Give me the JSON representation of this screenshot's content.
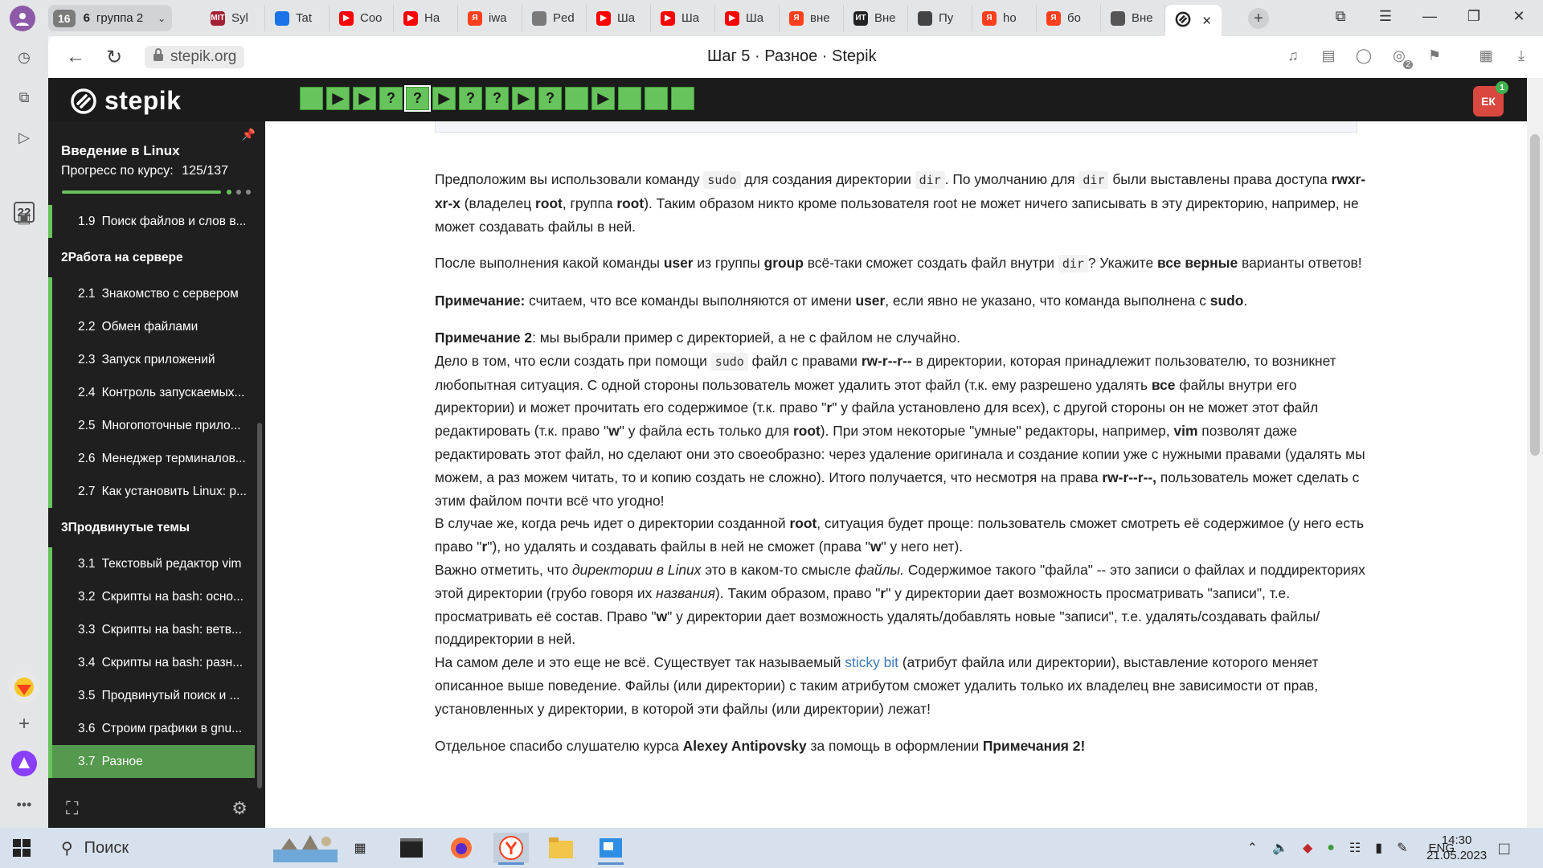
{
  "browser": {
    "tab_group": {
      "count": "16",
      "group_count": "6",
      "group_name": "группа 2"
    },
    "tabs": [
      {
        "label": "Syl",
        "fav_text": "MIT",
        "fav_color": "#a31f34"
      },
      {
        "label": "Tat",
        "fav_text": "",
        "fav_color": "#1a73e8"
      },
      {
        "label": "Coo",
        "fav_text": "▶",
        "fav_color": "#ff0000"
      },
      {
        "label": "Ha",
        "fav_text": "▶",
        "fav_color": "#ff0000"
      },
      {
        "label": "iwa",
        "fav_text": "Я",
        "fav_color": "#fc3f1d"
      },
      {
        "label": "Ped",
        "fav_text": "",
        "fav_color": "#7a7a7a"
      },
      {
        "label": "Ша",
        "fav_text": "▶",
        "fav_color": "#ff0000"
      },
      {
        "label": "Ша",
        "fav_text": "▶",
        "fav_color": "#ff0000"
      },
      {
        "label": "Ша",
        "fav_text": "▶",
        "fav_color": "#ff0000"
      },
      {
        "label": "вне",
        "fav_text": "Я",
        "fav_color": "#fc3f1d"
      },
      {
        "label": "Вне",
        "fav_text": "ИТ",
        "fav_color": "#222222"
      },
      {
        "label": "Пу",
        "fav_text": "",
        "fav_color": "#444444"
      },
      {
        "label": "ho",
        "fav_text": "Я",
        "fav_color": "#fc3f1d"
      },
      {
        "label": "бо",
        "fav_text": "Я",
        "fav_color": "#fc3f1d"
      },
      {
        "label": "Вне",
        "fav_text": "",
        "fav_color": "#555555"
      }
    ],
    "url": "stepik.org",
    "page_title": "Шаг 5 · Разное · Stepik",
    "sidebar_badge": "22",
    "addr_icon_badge": "2"
  },
  "stepik": {
    "logo_text": "stepik",
    "steps": [
      "",
      "▶",
      "▶",
      "?",
      "?",
      "▶",
      "?",
      "?",
      "▶",
      "?",
      "",
      "▶",
      "",
      "",
      ""
    ],
    "current_step_index": 4,
    "avatar_initials": "ЕК",
    "avatar_notifications": "1",
    "course_title": "Введение в Linux",
    "progress_label": "Прогресс по курсу:",
    "progress_value": "125/137",
    "progress_fraction": 0.912
  },
  "course_nav": [
    {
      "type": "item",
      "num": "1.9",
      "label": "Поиск файлов и слов в..."
    },
    {
      "type": "section",
      "num": "2",
      "label": "Работа на сервере"
    },
    {
      "type": "item",
      "num": "2.1",
      "label": "Знакомство с сервером"
    },
    {
      "type": "item",
      "num": "2.2",
      "label": "Обмен файлами"
    },
    {
      "type": "item",
      "num": "2.3",
      "label": "Запуск приложений"
    },
    {
      "type": "item",
      "num": "2.4",
      "label": "Контроль запускаемых..."
    },
    {
      "type": "item",
      "num": "2.5",
      "label": "Многопоточные прило..."
    },
    {
      "type": "item",
      "num": "2.6",
      "label": "Менеджер терминалов..."
    },
    {
      "type": "item",
      "num": "2.7",
      "label": "Как установить Linux: р..."
    },
    {
      "type": "section",
      "num": "3",
      "label": "Продвинутые темы"
    },
    {
      "type": "item",
      "num": "3.1",
      "label": "Текстовый редактор vim"
    },
    {
      "type": "item",
      "num": "3.2",
      "label": "Скрипты на bash: осно..."
    },
    {
      "type": "item",
      "num": "3.3",
      "label": "Скрипты на bash: ветв..."
    },
    {
      "type": "item",
      "num": "3.4",
      "label": "Скрипты на bash: разн..."
    },
    {
      "type": "item",
      "num": "3.5",
      "label": "Продвинутый поиск и ..."
    },
    {
      "type": "item",
      "num": "3.6",
      "label": "Строим графики в gnu..."
    },
    {
      "type": "item",
      "num": "3.7",
      "label": "Разное",
      "active": true
    }
  ],
  "lesson": {
    "p1": [
      {
        "t": "Предположим вы использовали команду "
      },
      {
        "t": "sudo",
        "f": "code"
      },
      {
        "t": " для создания директории "
      },
      {
        "t": "dir",
        "f": "code"
      },
      {
        "t": ". По умолчанию для "
      },
      {
        "t": "dir",
        "f": "code"
      },
      {
        "t": " были выставлены права доступа "
      },
      {
        "t": "rwxr-xr-x",
        "f": "b"
      },
      {
        "t": " (владелец "
      },
      {
        "t": "root",
        "f": "b"
      },
      {
        "t": ", группа "
      },
      {
        "t": "root",
        "f": "b"
      },
      {
        "t": "). Таким образом никто кроме пользователя root не может ничего записывать в эту директорию, например, не может создавать файлы в ней."
      }
    ],
    "p2": [
      {
        "t": "После выполнения какой команды "
      },
      {
        "t": "user",
        "f": "b"
      },
      {
        "t": " из группы "
      },
      {
        "t": "group",
        "f": "b"
      },
      {
        "t": " всё-таки сможет создать файл внутри "
      },
      {
        "t": "dir",
        "f": "code"
      },
      {
        "t": "? Укажите "
      },
      {
        "t": "все верные",
        "f": "b"
      },
      {
        "t": " варианты ответов!"
      }
    ],
    "p3": [
      {
        "t": "Примечание:",
        "f": "b"
      },
      {
        "t": " считаем, что все команды выполняются от имени "
      },
      {
        "t": "user",
        "f": "b"
      },
      {
        "t": ", если явно не указано, что команда выполнена с "
      },
      {
        "t": "sudo",
        "f": "b"
      },
      {
        "t": "."
      }
    ],
    "p4": [
      {
        "t": "Примечание 2",
        "f": "b"
      },
      {
        "t": ": мы выбрали пример с директорией, а не с файлом не случайно."
      },
      {
        "t": "",
        "f": "br"
      },
      {
        "t": "Дело в том, что если создать при помощи "
      },
      {
        "t": "sudo",
        "f": "code"
      },
      {
        "t": " файл с правами "
      },
      {
        "t": "rw-r--r--",
        "f": "b"
      },
      {
        "t": " в директории, которая принадлежит пользователю, то возникнет любопытная ситуация. С одной стороны пользователь может удалить этот файл (т.к. ему разрешено удалять "
      },
      {
        "t": "все",
        "f": "b"
      },
      {
        "t": " файлы внутри его директории) и может прочитать его содержимое (т.к. право \""
      },
      {
        "t": "r",
        "f": "b"
      },
      {
        "t": "\" у файла установлено для всех), с другой стороны он не может этот файл редактировать (т.к. право \""
      },
      {
        "t": "w",
        "f": "b"
      },
      {
        "t": "\" у файла есть только для "
      },
      {
        "t": "root",
        "f": "b"
      },
      {
        "t": "). При этом некоторые \"умные\" редакторы, например, "
      },
      {
        "t": "vim",
        "f": "b"
      },
      {
        "t": " позволят даже редактировать этот файл, но сделают они это своеобразно: через удаление оригинала и создание копии уже с нужными правами (удалять мы можем, а раз можем читать, то и копию создать не сложно). Итого получается, что несмотря на права  "
      },
      {
        "t": "rw-r--r--,",
        "f": "b"
      },
      {
        "t": " пользователь может сделать с этим файлом почти всё что угодно!"
      },
      {
        "t": "",
        "f": "br"
      },
      {
        "t": "В случае же, когда речь идет о директории созданной "
      },
      {
        "t": "root",
        "f": "b"
      },
      {
        "t": ", ситуация будет проще: пользователь сможет смотреть её содержимое (у него есть право \""
      },
      {
        "t": "r",
        "f": "b"
      },
      {
        "t": "\"), но удалять и создавать файлы в ней не сможет (права \""
      },
      {
        "t": "w",
        "f": "b"
      },
      {
        "t": "\" у него нет)."
      },
      {
        "t": "",
        "f": "br"
      },
      {
        "t": "Важно отметить, что "
      },
      {
        "t": "директории в Linux",
        "f": "i"
      },
      {
        "t": " это в каком-то смысле "
      },
      {
        "t": "файлы.",
        "f": "i"
      },
      {
        "t": " Содержимое такого \"файла\" -- это записи о файлах и поддиректориях этой директории (грубо говоря их "
      },
      {
        "t": "названия",
        "f": "i"
      },
      {
        "t": "). Таким образом, право \""
      },
      {
        "t": "r",
        "f": "b"
      },
      {
        "t": "\" у директории дает возможность просматривать \"записи\", т.е. просматривать её состав. Право \""
      },
      {
        "t": "w",
        "f": "b"
      },
      {
        "t": "\" у директории дает возможность удалять/добавлять новые \"записи\", т.е. удалять/создавать файлы/поддиректории в ней."
      },
      {
        "t": "",
        "f": "br"
      },
      {
        "t": "На самом деле и это еще не всё. Существует так называемый "
      },
      {
        "t": "sticky bit",
        "f": "a"
      },
      {
        "t": " (атрибут файла или директории), выставление которого меняет описанное выше поведение. Файлы (или директории) с таким атрибутом сможет удалить только их владелец вне зависимости от прав, установленных у директории, в которой эти файлы (или директории) лежат!"
      }
    ],
    "p5": [
      {
        "t": "Отдельное спасибо слушателю курса "
      },
      {
        "t": "Alexey Antipovsky",
        "f": "b"
      },
      {
        "t": " за помощь в оформлении "
      },
      {
        "t": "Примечания 2!",
        "f": "b"
      }
    ]
  },
  "taskbar": {
    "search_placeholder": "Поиск",
    "lang": "ENG",
    "time": "14:30",
    "date": "21.05.2023"
  },
  "colors": {
    "stepik_green": "#67c35b",
    "active_nav": "#54994d",
    "header_bg": "#1b1b1b",
    "sidebar_bg": "#1f1f1f",
    "link": "#3c7ab8"
  }
}
